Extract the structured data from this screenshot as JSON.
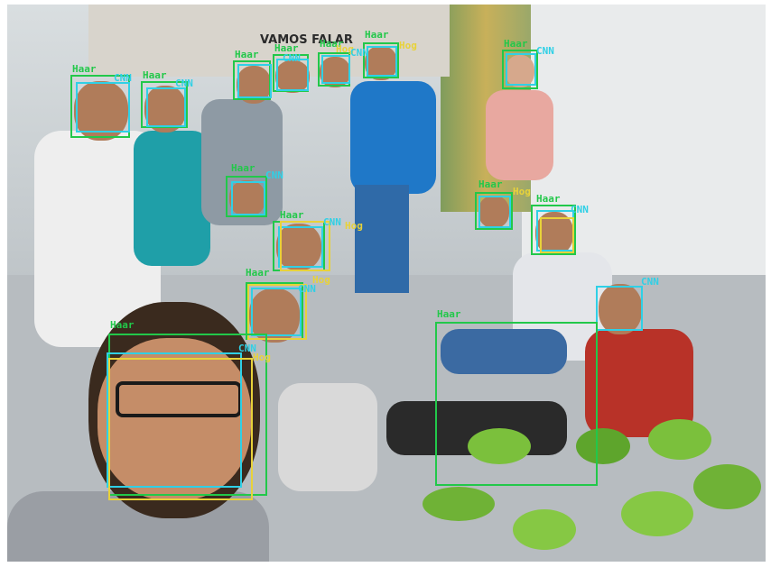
{
  "labels": {
    "haar": "Haar",
    "cnn": "CNN",
    "hog": "Hog"
  },
  "wall_sign": "VAMOS FALAR",
  "colors": {
    "haar": "#22c84a",
    "cnn": "#2fd0e6",
    "hog": "#e8d23a"
  }
}
